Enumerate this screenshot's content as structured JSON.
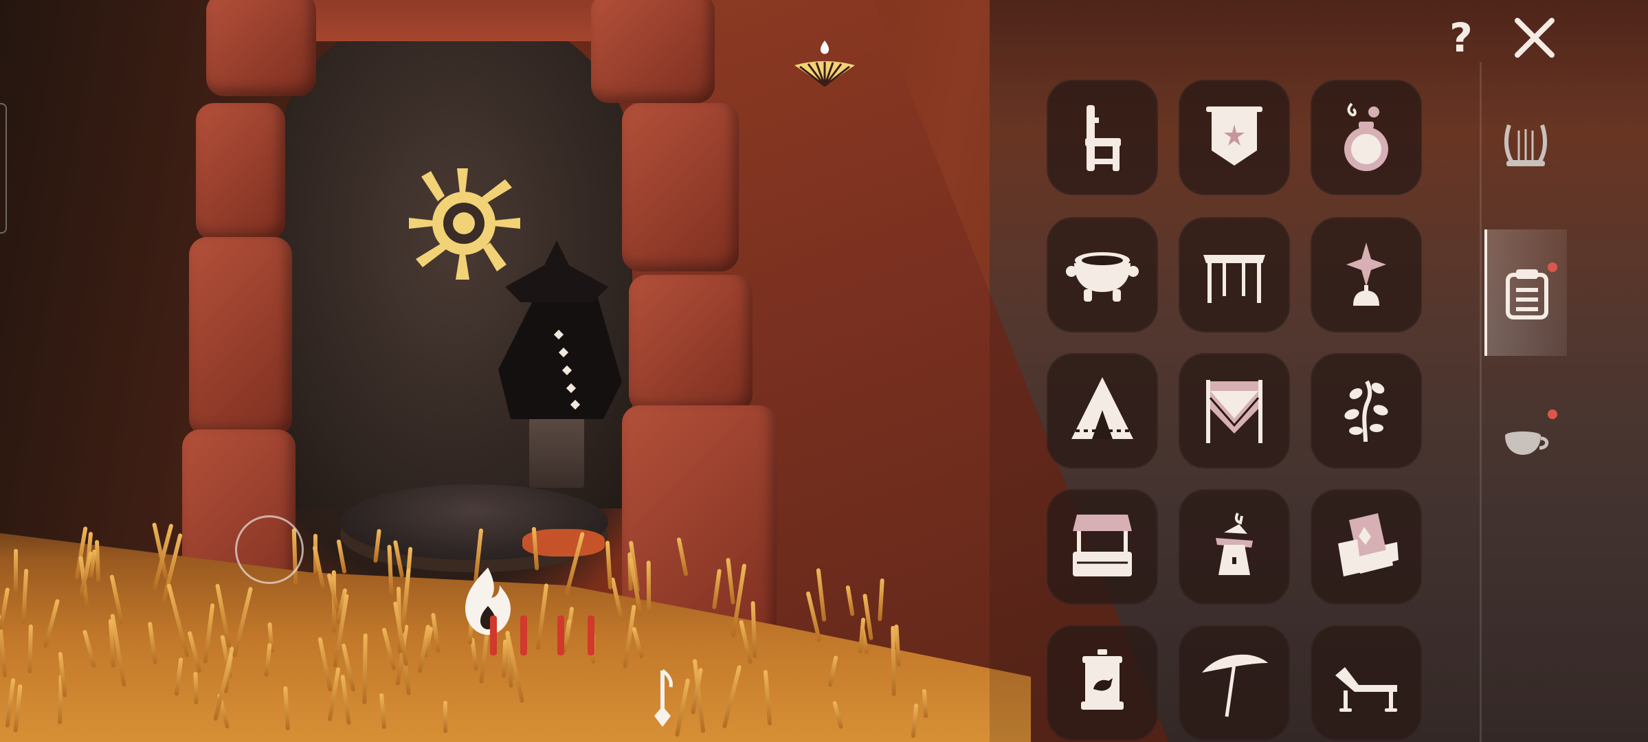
{
  "hud": {
    "help_label": "?",
    "icons": {
      "close": "close-icon",
      "joystick": "joystick-icon",
      "winged_light": "winged-light-fan-icon",
      "candle": "candle-flame-icon",
      "music": "music-note-icon",
      "wall_glyph": "sun-glyph-icon"
    }
  },
  "props_panel": {
    "items": [
      {
        "name": "chair-icon"
      },
      {
        "name": "banner-icon"
      },
      {
        "name": "potion-icon"
      },
      {
        "name": "cauldron-icon"
      },
      {
        "name": "canopy-icon"
      },
      {
        "name": "lamp-icon"
      },
      {
        "name": "tent-icon"
      },
      {
        "name": "curtain-icon"
      },
      {
        "name": "plant-icon"
      },
      {
        "name": "stall-icon"
      },
      {
        "name": "scarecrow-icon"
      },
      {
        "name": "armchair-icon"
      },
      {
        "name": "birdcage-icon"
      },
      {
        "name": "umbrella-icon"
      },
      {
        "name": "lounger-icon"
      }
    ]
  },
  "side_tabs": [
    {
      "name": "harp-icon",
      "active": false,
      "notification": false
    },
    {
      "name": "clipboard-icon",
      "active": true,
      "notification": true
    },
    {
      "name": "teacup-icon",
      "active": false,
      "notification": true
    }
  ],
  "colors": {
    "icon": "#f4ece4",
    "icon_accent": "#d6b0b4",
    "tile_bg": "#2a1a16",
    "notification": "#d9584c",
    "glyph_gold": "#f2d276"
  }
}
